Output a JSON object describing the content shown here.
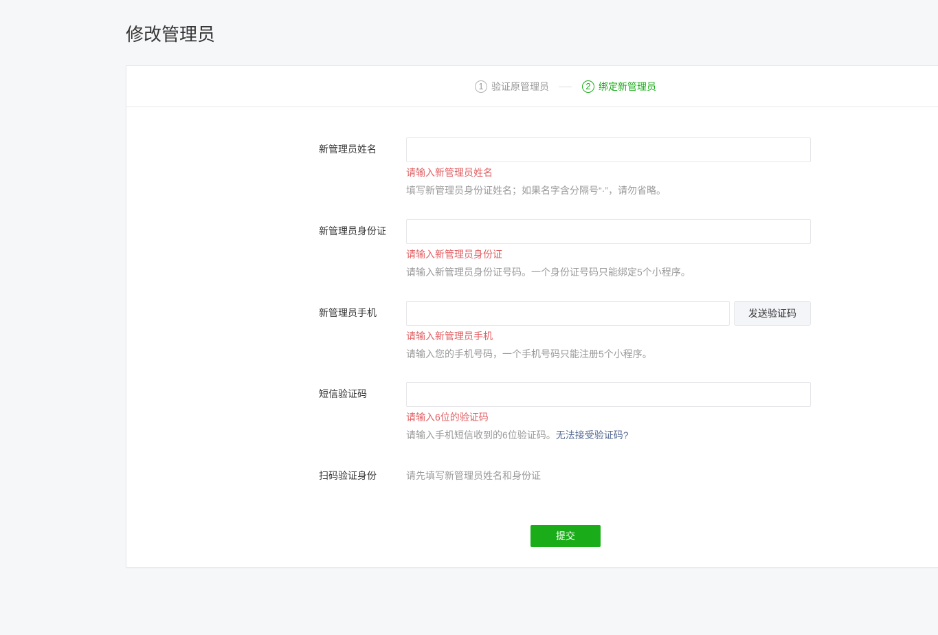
{
  "page": {
    "title": "修改管理员"
  },
  "steps": [
    {
      "number": "1",
      "label": "验证原管理员",
      "active": false
    },
    {
      "number": "2",
      "label": "绑定新管理员",
      "active": true
    }
  ],
  "form": {
    "name": {
      "label": "新管理员姓名",
      "value": "",
      "error": "请输入新管理员姓名",
      "hint": "填写新管理员身份证姓名；如果名字含分隔号“·”，请勿省略。"
    },
    "id_card": {
      "label": "新管理员身份证",
      "value": "",
      "error": "请输入新管理员身份证",
      "hint": "请输入新管理员身份证号码。一个身份证号码只能绑定5个小程序。"
    },
    "phone": {
      "label": "新管理员手机",
      "value": "",
      "send_code_button": "发送验证码",
      "error": "请输入新管理员手机",
      "hint": "请输入您的手机号码，一个手机号码只能注册5个小程序。"
    },
    "sms_code": {
      "label": "短信验证码",
      "value": "",
      "error": "请输入6位的验证码",
      "hint": "请输入手机短信收到的6位验证码。",
      "hint_link": "无法接受验证码?"
    },
    "scan": {
      "label": "扫码验证身份",
      "text": "请先填写新管理员姓名和身份证"
    }
  },
  "submit_label": "提交",
  "colors": {
    "brand_green": "#1aad19",
    "error_red": "#e15f63",
    "link_blue": "#576b95"
  }
}
